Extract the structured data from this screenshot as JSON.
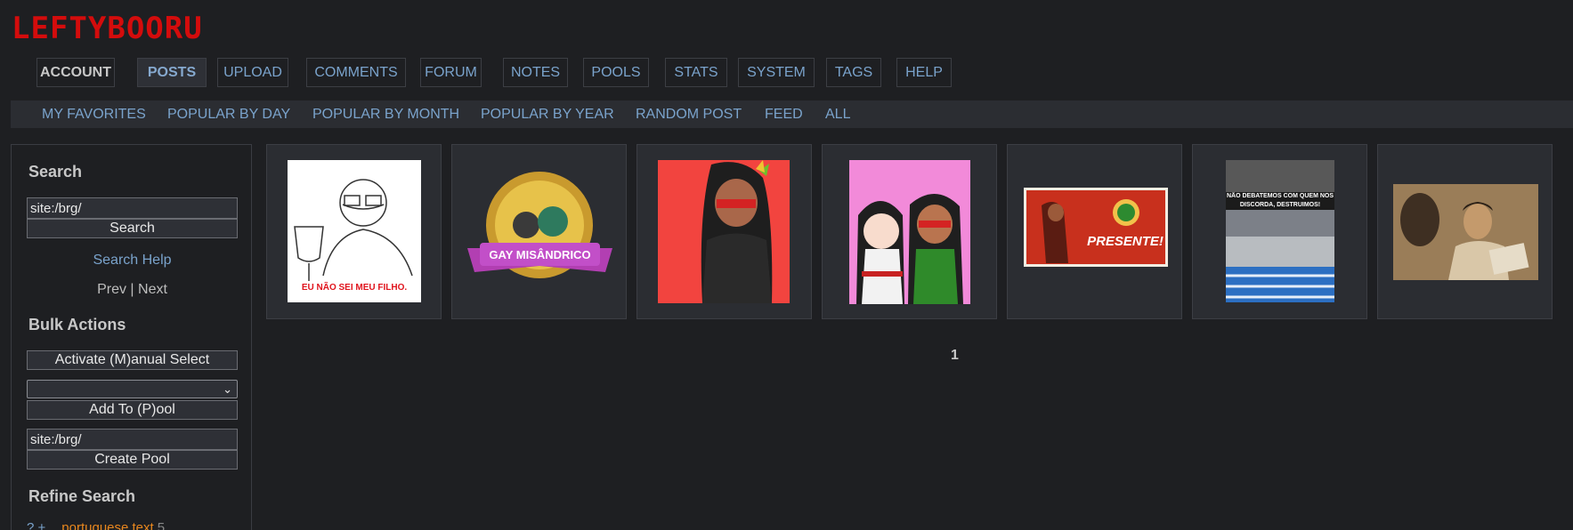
{
  "site": {
    "logo": "LEFTYBOORU"
  },
  "main_nav": [
    "ACCOUNT",
    "POSTS",
    "UPLOAD",
    "COMMENTS",
    "FORUM",
    "NOTES",
    "POOLS",
    "STATS",
    "SYSTEM",
    "TAGS",
    "HELP"
  ],
  "sub_nav": [
    "MY FAVORITES",
    "POPULAR BY DAY",
    "POPULAR BY MONTH",
    "POPULAR BY YEAR",
    "RANDOM POST",
    "FEED",
    "ALL"
  ],
  "sidebar": {
    "search_heading": "Search",
    "search_value": "site:/brg/",
    "search_button": "Search",
    "search_help": "Search Help",
    "prev": "Prev",
    "separator": "|",
    "next": "Next",
    "bulk_heading": "Bulk Actions",
    "activate_button": "Activate (M)anual Select",
    "add_to_pool_button": "Add To (P)ool",
    "pool_value": "site:/brg/",
    "create_pool_button": "Create Pool",
    "refine_heading": "Refine Search",
    "refine_item": {
      "ops": "? +",
      "tag": "portuguese text",
      "count": "5"
    }
  },
  "thumbnails": [
    {
      "caption": "EU NÃO SEI MEU FILHO."
    },
    {
      "caption": "GAY MISÂNDRICO"
    },
    {
      "caption": ""
    },
    {
      "caption": ""
    },
    {
      "caption": "PRESENTE!"
    },
    {
      "caption": "NÃO DEBATEMOS COM QUEM NOS DISCORDA, DESTRUIMOS!"
    },
    {
      "caption": ""
    }
  ],
  "pagination": {
    "current": "1"
  },
  "colors": {
    "accent": "#d40c0c",
    "link": "#7aa3cc",
    "tag": "#e8871e"
  }
}
